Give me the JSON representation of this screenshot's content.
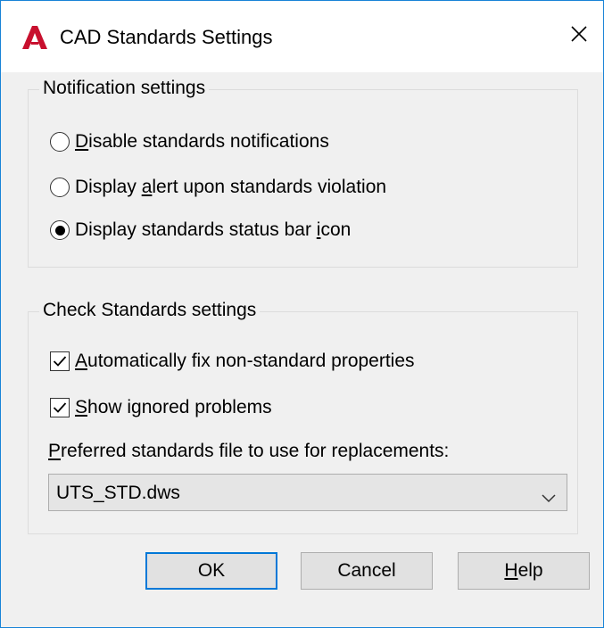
{
  "window": {
    "title": "CAD Standards Settings",
    "app_icon": "autocad-a-icon",
    "close_glyph": "✕",
    "accent_color": "#1883d7",
    "icon_color": "#c8102e"
  },
  "notification": {
    "legend": "Notification settings",
    "options": [
      {
        "pre": "",
        "u": "D",
        "post": "isable standards notifications",
        "selected": false
      },
      {
        "pre": "Display ",
        "u": "a",
        "post": "lert upon standards violation",
        "selected": false
      },
      {
        "pre": "Display standards status bar ",
        "u": "i",
        "post": "con",
        "selected": true
      }
    ]
  },
  "check_standards": {
    "legend": "Check Standards settings",
    "auto_fix": {
      "pre": "",
      "u": "A",
      "post": "utomatically fix non-standard properties",
      "checked": true
    },
    "show_ignored": {
      "pre": "",
      "u": "S",
      "post": "how ignored problems",
      "checked": true
    },
    "preferred_label": {
      "pre": "",
      "u": "P",
      "post": "referred standards file to use for replacements:"
    },
    "preferred_file": {
      "value": "UTS_STD.dws",
      "arrow_icon": "chevron-down-icon"
    }
  },
  "buttons": {
    "ok": "OK",
    "cancel": "Cancel",
    "help": {
      "pre": "",
      "u": "H",
      "post": "elp"
    }
  }
}
